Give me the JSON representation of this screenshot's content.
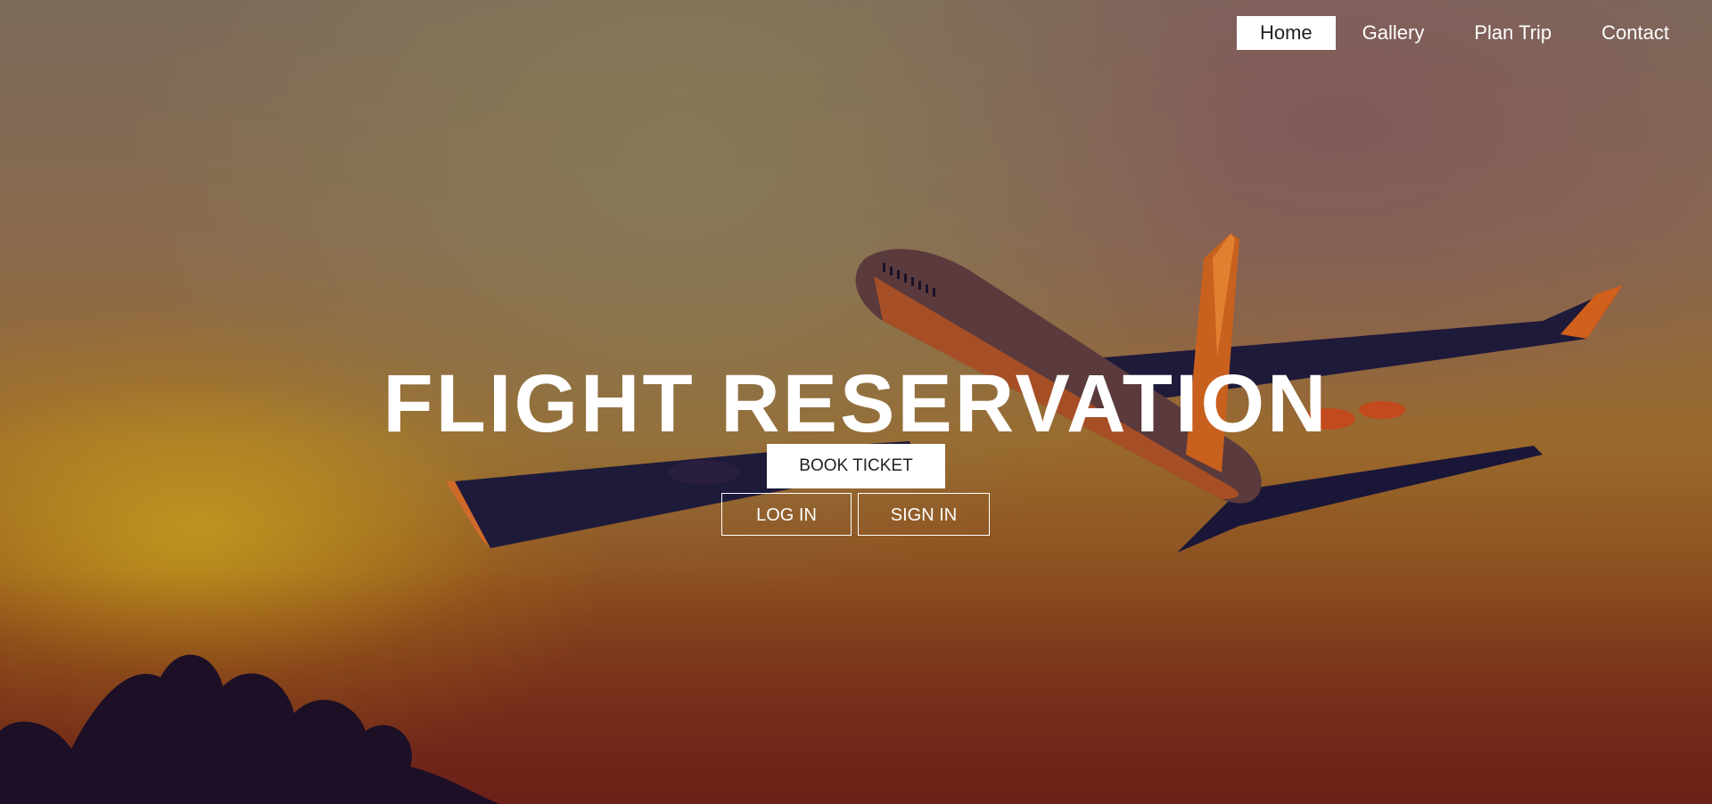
{
  "nav": {
    "items": [
      {
        "label": "Home",
        "active": true
      },
      {
        "label": "Gallery",
        "active": false
      },
      {
        "label": "Plan Trip",
        "active": false
      },
      {
        "label": "Contact",
        "active": false
      }
    ]
  },
  "hero": {
    "title": "FLIGHT RESERVATION",
    "book_label": "BOOK TICKET",
    "login_label": "LOG IN",
    "signin_label": "SIGN IN"
  },
  "colors": {
    "nav_active_bg": "#ffffff",
    "text": "#ffffff",
    "sky_top": "#7b6a5a",
    "sky_bottom": "#6a2418"
  }
}
